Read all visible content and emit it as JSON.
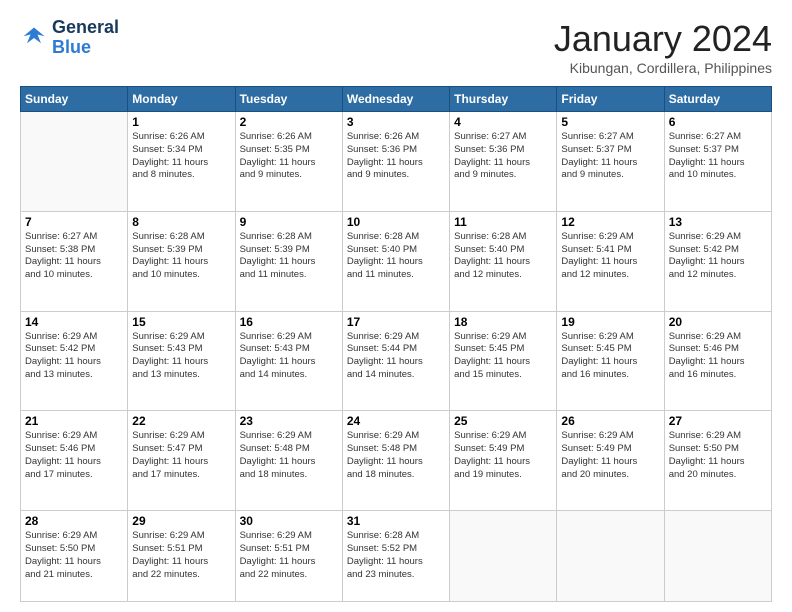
{
  "logo": {
    "line1": "General",
    "line2": "Blue"
  },
  "title": "January 2024",
  "location": "Kibungan, Cordillera, Philippines",
  "days_of_week": [
    "Sunday",
    "Monday",
    "Tuesday",
    "Wednesday",
    "Thursday",
    "Friday",
    "Saturday"
  ],
  "weeks": [
    [
      {
        "num": "",
        "detail": ""
      },
      {
        "num": "1",
        "detail": "Sunrise: 6:26 AM\nSunset: 5:34 PM\nDaylight: 11 hours\nand 8 minutes."
      },
      {
        "num": "2",
        "detail": "Sunrise: 6:26 AM\nSunset: 5:35 PM\nDaylight: 11 hours\nand 9 minutes."
      },
      {
        "num": "3",
        "detail": "Sunrise: 6:26 AM\nSunset: 5:36 PM\nDaylight: 11 hours\nand 9 minutes."
      },
      {
        "num": "4",
        "detail": "Sunrise: 6:27 AM\nSunset: 5:36 PM\nDaylight: 11 hours\nand 9 minutes."
      },
      {
        "num": "5",
        "detail": "Sunrise: 6:27 AM\nSunset: 5:37 PM\nDaylight: 11 hours\nand 9 minutes."
      },
      {
        "num": "6",
        "detail": "Sunrise: 6:27 AM\nSunset: 5:37 PM\nDaylight: 11 hours\nand 10 minutes."
      }
    ],
    [
      {
        "num": "7",
        "detail": "Sunrise: 6:27 AM\nSunset: 5:38 PM\nDaylight: 11 hours\nand 10 minutes."
      },
      {
        "num": "8",
        "detail": "Sunrise: 6:28 AM\nSunset: 5:39 PM\nDaylight: 11 hours\nand 10 minutes."
      },
      {
        "num": "9",
        "detail": "Sunrise: 6:28 AM\nSunset: 5:39 PM\nDaylight: 11 hours\nand 11 minutes."
      },
      {
        "num": "10",
        "detail": "Sunrise: 6:28 AM\nSunset: 5:40 PM\nDaylight: 11 hours\nand 11 minutes."
      },
      {
        "num": "11",
        "detail": "Sunrise: 6:28 AM\nSunset: 5:40 PM\nDaylight: 11 hours\nand 12 minutes."
      },
      {
        "num": "12",
        "detail": "Sunrise: 6:29 AM\nSunset: 5:41 PM\nDaylight: 11 hours\nand 12 minutes."
      },
      {
        "num": "13",
        "detail": "Sunrise: 6:29 AM\nSunset: 5:42 PM\nDaylight: 11 hours\nand 12 minutes."
      }
    ],
    [
      {
        "num": "14",
        "detail": "Sunrise: 6:29 AM\nSunset: 5:42 PM\nDaylight: 11 hours\nand 13 minutes."
      },
      {
        "num": "15",
        "detail": "Sunrise: 6:29 AM\nSunset: 5:43 PM\nDaylight: 11 hours\nand 13 minutes."
      },
      {
        "num": "16",
        "detail": "Sunrise: 6:29 AM\nSunset: 5:43 PM\nDaylight: 11 hours\nand 14 minutes."
      },
      {
        "num": "17",
        "detail": "Sunrise: 6:29 AM\nSunset: 5:44 PM\nDaylight: 11 hours\nand 14 minutes."
      },
      {
        "num": "18",
        "detail": "Sunrise: 6:29 AM\nSunset: 5:45 PM\nDaylight: 11 hours\nand 15 minutes."
      },
      {
        "num": "19",
        "detail": "Sunrise: 6:29 AM\nSunset: 5:45 PM\nDaylight: 11 hours\nand 16 minutes."
      },
      {
        "num": "20",
        "detail": "Sunrise: 6:29 AM\nSunset: 5:46 PM\nDaylight: 11 hours\nand 16 minutes."
      }
    ],
    [
      {
        "num": "21",
        "detail": "Sunrise: 6:29 AM\nSunset: 5:46 PM\nDaylight: 11 hours\nand 17 minutes."
      },
      {
        "num": "22",
        "detail": "Sunrise: 6:29 AM\nSunset: 5:47 PM\nDaylight: 11 hours\nand 17 minutes."
      },
      {
        "num": "23",
        "detail": "Sunrise: 6:29 AM\nSunset: 5:48 PM\nDaylight: 11 hours\nand 18 minutes."
      },
      {
        "num": "24",
        "detail": "Sunrise: 6:29 AM\nSunset: 5:48 PM\nDaylight: 11 hours\nand 18 minutes."
      },
      {
        "num": "25",
        "detail": "Sunrise: 6:29 AM\nSunset: 5:49 PM\nDaylight: 11 hours\nand 19 minutes."
      },
      {
        "num": "26",
        "detail": "Sunrise: 6:29 AM\nSunset: 5:49 PM\nDaylight: 11 hours\nand 20 minutes."
      },
      {
        "num": "27",
        "detail": "Sunrise: 6:29 AM\nSunset: 5:50 PM\nDaylight: 11 hours\nand 20 minutes."
      }
    ],
    [
      {
        "num": "28",
        "detail": "Sunrise: 6:29 AM\nSunset: 5:50 PM\nDaylight: 11 hours\nand 21 minutes."
      },
      {
        "num": "29",
        "detail": "Sunrise: 6:29 AM\nSunset: 5:51 PM\nDaylight: 11 hours\nand 22 minutes."
      },
      {
        "num": "30",
        "detail": "Sunrise: 6:29 AM\nSunset: 5:51 PM\nDaylight: 11 hours\nand 22 minutes."
      },
      {
        "num": "31",
        "detail": "Sunrise: 6:28 AM\nSunset: 5:52 PM\nDaylight: 11 hours\nand 23 minutes."
      },
      {
        "num": "",
        "detail": ""
      },
      {
        "num": "",
        "detail": ""
      },
      {
        "num": "",
        "detail": ""
      }
    ]
  ]
}
